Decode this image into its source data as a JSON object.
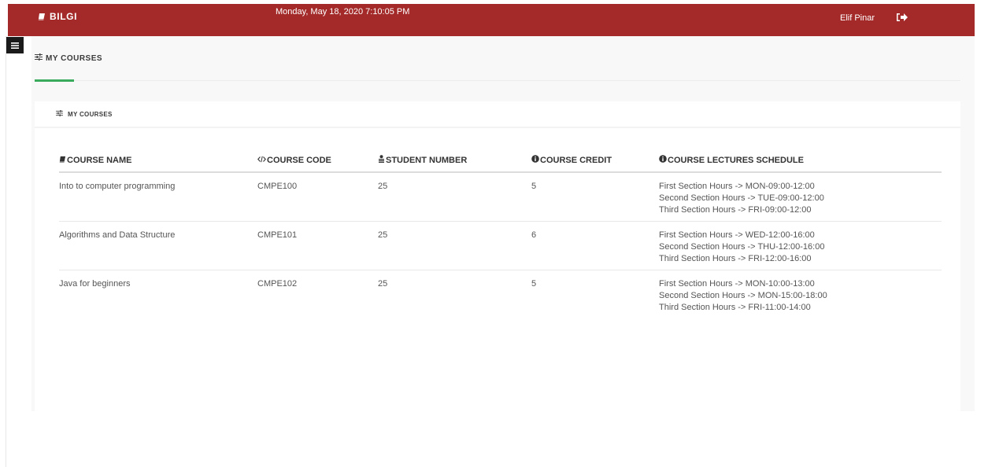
{
  "header": {
    "brand": "BILGI",
    "datetime": "Monday, May 18, 2020 7:10:05 PM",
    "user": "Elif Pinar",
    "logout_icon": "sign-out-icon",
    "brand_icon": "book-icon"
  },
  "sidebar_toggle": {
    "icon": "hamburger-menu-icon"
  },
  "page": {
    "title": "MY COURSES",
    "title_icon": "sliders-icon"
  },
  "panel": {
    "title": "MY COURSES",
    "title_icon": "sliders-icon"
  },
  "table": {
    "headers": [
      {
        "label": "COURSE NAME",
        "icon": "book-icon"
      },
      {
        "label": "COURSE CODE",
        "icon": "code-icon"
      },
      {
        "label": "STUDENT NUMBER",
        "icon": "users-icon"
      },
      {
        "label": "COURSE CREDIT",
        "icon": "info-circle-icon"
      },
      {
        "label": "COURSE LECTURES SCHEDULE",
        "icon": "info-circle-icon"
      }
    ],
    "rows": [
      {
        "name": "Into to computer programming",
        "code": "CMPE100",
        "students": "25",
        "credit": "5",
        "schedule": [
          "First Section Hours -> MON-09:00-12:00",
          "Second Section Hours -> TUE-09:00-12:00",
          "Third Section Hours -> FRI-09:00-12:00"
        ]
      },
      {
        "name": "Algorithms and Data Structure",
        "code": "CMPE101",
        "students": "25",
        "credit": "6",
        "schedule": [
          "First Section Hours -> WED-12:00-16:00",
          "Second Section Hours -> THU-12:00-16:00",
          "Third Section Hours -> FRI-12:00-16:00"
        ]
      },
      {
        "name": "Java for beginners",
        "code": "CMPE102",
        "students": "25",
        "credit": "5",
        "schedule": [
          "First Section Hours -> MON-10:00-13:00",
          "Second Section Hours -> MON-15:00-18:00",
          "Third Section Hours -> FRI-11:00-14:00"
        ]
      }
    ]
  },
  "colors": {
    "topbar": "#a32a29",
    "accent": "#3aaa5c"
  }
}
